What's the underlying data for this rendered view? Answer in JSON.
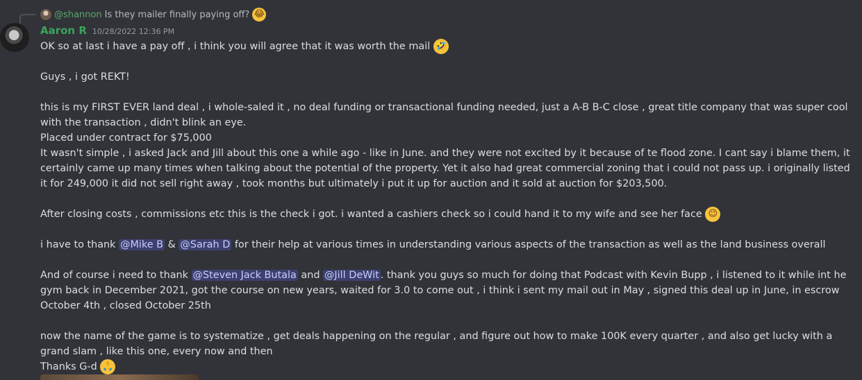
{
  "reply": {
    "mention": "@shannon",
    "text": "Is they mailer finally paying off?",
    "emoji": "😂"
  },
  "message": {
    "author": "Aaron R",
    "timestamp": "10/28/2022 12:36 PM",
    "author_color": "#3ba55c",
    "line1": "OK so at last i have a pay off , i think you will agree that it was worth the mail",
    "line1_emoji": "🤣",
    "line2": "Guys , i got REKT!",
    "para3": "this is my FIRST EVER land deal , i whole-saled it , no deal funding or transactional funding needed, just a A-B B-C close , great title company that was super cool with the transaction , didn't blink an eye.",
    "line4": "Placed under contract for $75,000",
    "para5": "It wasn't simple , i asked Jack and Jill about this one a while ago - like in June. and they were not excited by it because of te flood zone. I cant say i blame them, it certainly came up many times when talking about the potential of the property. Yet it also had great commercial zoning that i could not pass up. i originally listed it for 249,000 it did not sell right away , took months but ultimately i put it up for auction and it sold at auction for $203,500.",
    "para6": "After closing costs , commissions etc this is the check i got. i wanted a cashiers check so i could hand it to my wife and see her face",
    "para6_emoji": "😉",
    "thanks_prefix": "i have to thank",
    "mention_mike": "@Mike B",
    "thanks_amp": "&",
    "mention_sarah": "@Sarah D",
    "thanks_suffix": "for their help at various times in understanding various aspects of the transaction as well as the land business overall",
    "course_prefix": "And of course i need to thank",
    "mention_steven": "@Steven Jack Butala",
    "course_and": "and",
    "mention_jill": "@Jill DeWit",
    "course_suffix": ". thank you guys so much for doing that Podcast with Kevin Bupp , i listened to it while int he gym back in December 2021, got the course on new years, waited for 3.0 to come out , i think i sent my mail out in May , signed this deal up in June, in escrow October 4th , closed October 25th",
    "para9": "now the name of the game is to systematize , get deals happening on the regular , and figure out how to make 100K every quarter , and also get lucky with a grand slam , like this one, every now and then",
    "signoff": "Thanks G-d",
    "signoff_emoji": "🙏"
  },
  "colors": {
    "background": "#313338",
    "mention_bg": "#3c4270",
    "mention_text": "#c9cdfb",
    "reply_mention": "#57a96a"
  }
}
